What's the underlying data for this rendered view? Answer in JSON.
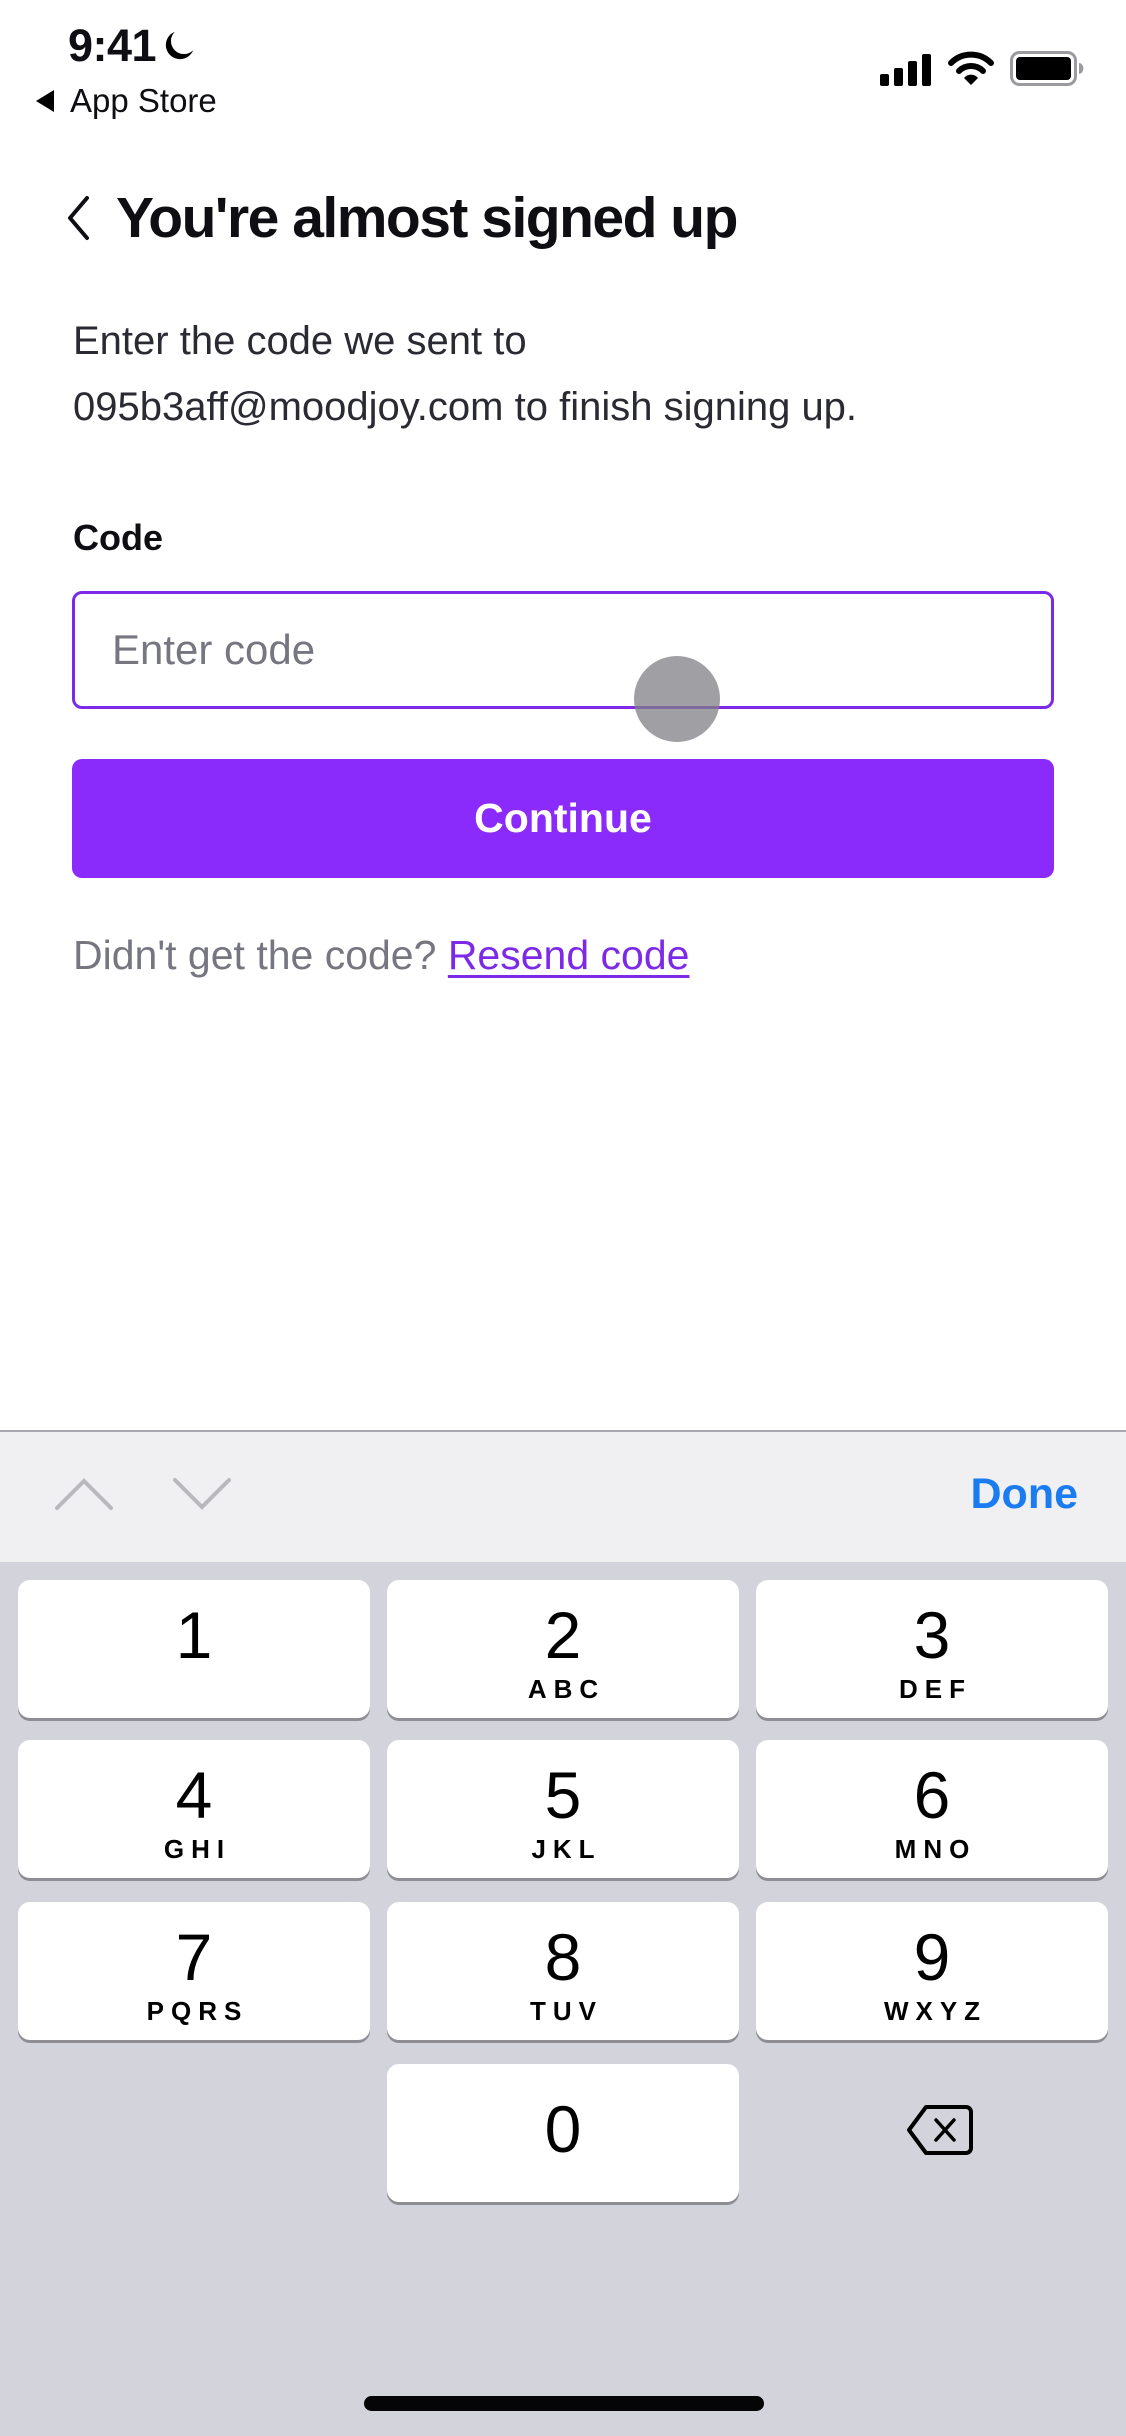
{
  "status_bar": {
    "time": "9:41",
    "focus_icon": "moon-icon",
    "back_app_label": "App Store",
    "icons": [
      "cellular-signal-icon",
      "wifi-icon",
      "battery-icon"
    ]
  },
  "header": {
    "back_icon": "chevron-left-icon",
    "title": "You're almost signed up"
  },
  "description": {
    "line1": "Enter the code we sent to",
    "line2": "095b3aff@moodjoy.com to finish signing up."
  },
  "form": {
    "code_label": "Code",
    "code_value": "",
    "code_placeholder": "Enter code",
    "continue_label": "Continue",
    "resend_prompt": "Didn't get the code?",
    "resend_link": "Resend code"
  },
  "keyboard_toolbar": {
    "prev_icon": "chevron-up-icon",
    "next_icon": "chevron-down-icon",
    "done_label": "Done"
  },
  "keypad": {
    "keys": [
      {
        "num": "1",
        "letters": ""
      },
      {
        "num": "2",
        "letters": "ABC"
      },
      {
        "num": "3",
        "letters": "DEF"
      },
      {
        "num": "4",
        "letters": "GHI"
      },
      {
        "num": "5",
        "letters": "JKL"
      },
      {
        "num": "6",
        "letters": "MNO"
      },
      {
        "num": "7",
        "letters": "PQRS"
      },
      {
        "num": "8",
        "letters": "TUV"
      },
      {
        "num": "9",
        "letters": "WXYZ"
      },
      {
        "num": "0",
        "letters": ""
      }
    ],
    "delete_icon": "backspace-icon"
  },
  "colors": {
    "brand_purple": "#8b2bfb",
    "input_border": "#7d2ae8",
    "link": "#7d2ae8",
    "done_blue": "#1a7cf0",
    "keyboard_bg": "#d3d3db",
    "toolbar_bg": "#f0f0f3"
  }
}
